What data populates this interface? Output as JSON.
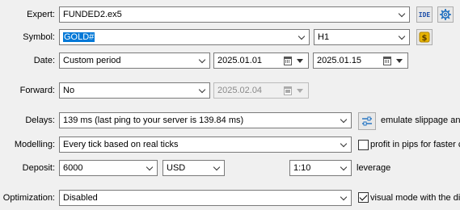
{
  "expert": {
    "label": "Expert:",
    "value": "FUNDED2.ex5",
    "ide_label": "IDE"
  },
  "symbol": {
    "label": "Symbol:",
    "value": "GOLD#",
    "timeframe": "H1"
  },
  "date": {
    "label": "Date:",
    "period": "Custom period",
    "from": "2025.01.01",
    "to": "2025.01.15"
  },
  "forward": {
    "label": "Forward:",
    "value": "No",
    "date": "2025.02.04"
  },
  "delays": {
    "label": "Delays:",
    "value": "139 ms (last ping to your server is 139.84 ms)",
    "emulate_label": "emulate slippage and"
  },
  "modelling": {
    "label": "Modelling:",
    "value": "Every tick based on real ticks",
    "profit_pips_label": "profit in pips for faster ca",
    "profit_pips_checked": false
  },
  "deposit": {
    "label": "Deposit:",
    "amount": "6000",
    "currency": "USD",
    "leverage": "1:10",
    "leverage_label": "leverage"
  },
  "optimization": {
    "label": "Optimization:",
    "value": "Disabled",
    "visual_mode_label": "visual mode with the dis",
    "visual_mode_checked": true
  },
  "colors": {
    "selection": "#0078d7",
    "background": "#f0f0f0",
    "gear": "#1e6fbf",
    "coin": "#e8b400"
  }
}
